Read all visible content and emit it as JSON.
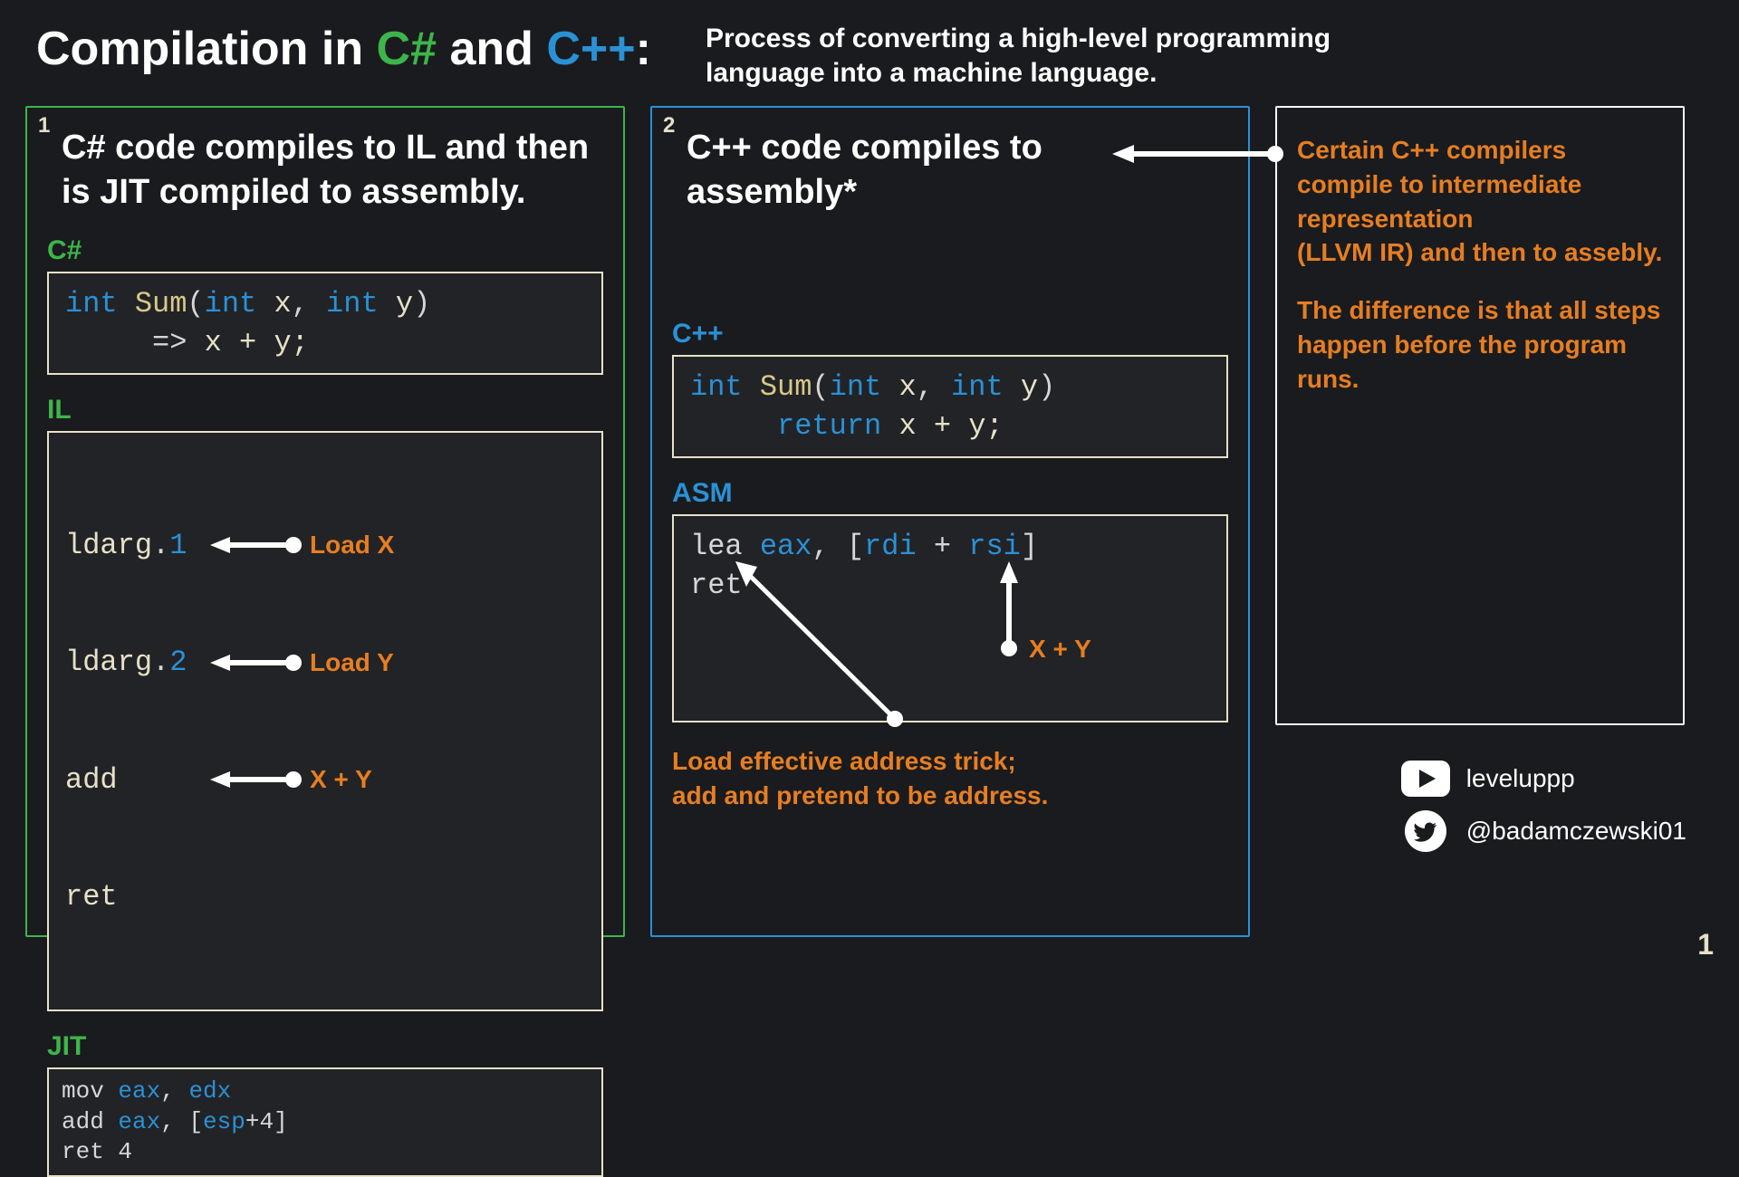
{
  "header": {
    "title_prefix": "Compilation in ",
    "title_csharp": "C#",
    "title_and": " and ",
    "title_cpp": "C++",
    "title_suffix": ":",
    "subtitle": "Process of converting a high-level programming language into a machine language."
  },
  "panels": {
    "csharp": {
      "index": "1",
      "heading": "C# code compiles to IL and then is JIT compiled to assembly.",
      "labels": {
        "source": "C#",
        "il": "IL",
        "jit": "JIT"
      },
      "code_source": {
        "kw1": "int",
        "fn": "Sum",
        "paren_open": "(",
        "kw2": "int",
        "p1": "x",
        "comma": ", ",
        "kw3": "int",
        "p2": "y",
        "paren_close": ")",
        "line2_indent": "     ",
        "arrow": "=>",
        "expr": " x + y;"
      },
      "code_il": [
        {
          "mnem": "ldarg",
          "dot": ".",
          "arg": "1",
          "label": "Load X"
        },
        {
          "mnem": "ldarg",
          "dot": ".",
          "arg": "2",
          "label": "Load Y"
        },
        {
          "mnem": "add",
          "dot": "",
          "arg": "",
          "label": "X + Y"
        },
        {
          "mnem": "ret",
          "dot": "",
          "arg": "",
          "label": ""
        }
      ],
      "code_jit": {
        "l1_m": "mov",
        "l1_a": "eax",
        "l1_c": ", ",
        "l1_b": "edx",
        "l2_m": "add",
        "l2_a": "eax",
        "l2_c": ", [",
        "l2_b": "esp",
        "l2_d": "+4]",
        "l3_m": "ret",
        "l3_a": " 4"
      }
    },
    "cpp": {
      "index": "2",
      "heading": "C++ code compiles to assembly*",
      "labels": {
        "source": "C++",
        "asm": "ASM"
      },
      "code_source": {
        "kw1": "int",
        "fn": "Sum",
        "paren_open": "(",
        "kw2": "int",
        "p1": "x",
        "comma": ", ",
        "kw3": "int",
        "p2": "y",
        "paren_close": ")",
        "line2_indent": "     ",
        "kw_ret": "return",
        "expr": " x + y;"
      },
      "code_asm": {
        "l1_m": "lea",
        "l1_sp": " ",
        "l1_a": "eax",
        "l1_c": ", [",
        "l1_b": "rdi",
        "l1_p": " + ",
        "l1_d": "rsi",
        "l1_e": "]",
        "l2_m": "ret"
      },
      "asm_annot_xy": "X + Y",
      "asm_note_l1": "Load effective address trick;",
      "asm_note_l2": "add and pretend to be address."
    },
    "side": {
      "p1": "Certain C++ compilers compile to intermediate representation",
      "p2": "(LLVM IR) and then to assebly.",
      "p3": "The difference is that all steps happen before the program runs."
    }
  },
  "socials": {
    "youtube": "leveluppp",
    "twitter": "@badamczewski01"
  },
  "page": "1"
}
